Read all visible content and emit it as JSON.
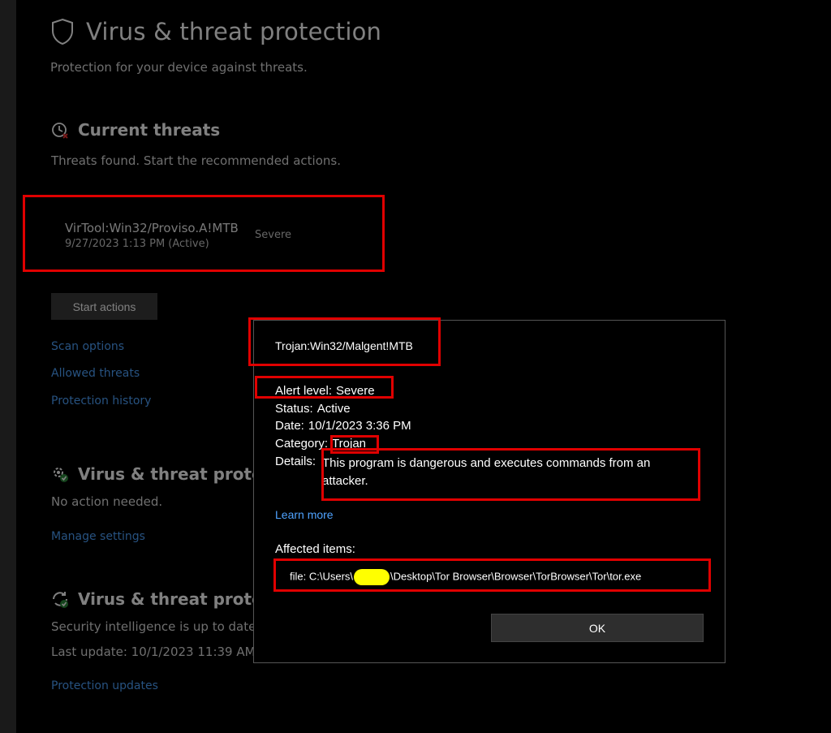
{
  "page": {
    "title": "Virus & threat protection",
    "subtitle": "Protection for your device against threats."
  },
  "current_threats": {
    "title": "Current threats",
    "description": "Threats found. Start the recommended actions.",
    "threat": {
      "name": "VirTool:Win32/Proviso.A!MTB",
      "date": "9/27/2023 1:13 PM (Active)",
      "severity": "Severe"
    },
    "start_button": "Start actions",
    "links": [
      "Scan options",
      "Allowed threats",
      "Protection history"
    ]
  },
  "settings_section": {
    "title": "Virus & threat protect",
    "description": "No action needed.",
    "link": "Manage settings"
  },
  "updates_section": {
    "title": "Virus & threat protect",
    "status": "Security intelligence is up to date.",
    "last_update": "Last update: 10/1/2023 11:39 AM",
    "link": "Protection updates"
  },
  "dialog": {
    "title": "Trojan:Win32/Malgent!MTB",
    "alert_level": {
      "label": "Alert level:",
      "value": "Severe"
    },
    "status": {
      "label": "Status:",
      "value": "Active"
    },
    "date": {
      "label": "Date:",
      "value": "10/1/2023 3:36 PM"
    },
    "category": {
      "label": "Category:",
      "value": "Trojan"
    },
    "details": {
      "label": "Details:",
      "value": "This program is dangerous and executes commands from an attacker."
    },
    "learn_more": "Learn more",
    "affected_label": "Affected items:",
    "file_prefix": "file: C:\\Users\\",
    "file_suffix": "\\Desktop\\Tor Browser\\Browser\\TorBrowser\\Tor\\tor.exe",
    "ok_button": "OK"
  },
  "colors": {
    "background": "#000000",
    "link": "#4fa3ff",
    "highlight_box": "#e00000",
    "redaction": "#ffff00"
  },
  "icons": [
    "shield-icon",
    "clock-alert-icon",
    "gear-check-icon",
    "refresh-check-icon"
  ]
}
